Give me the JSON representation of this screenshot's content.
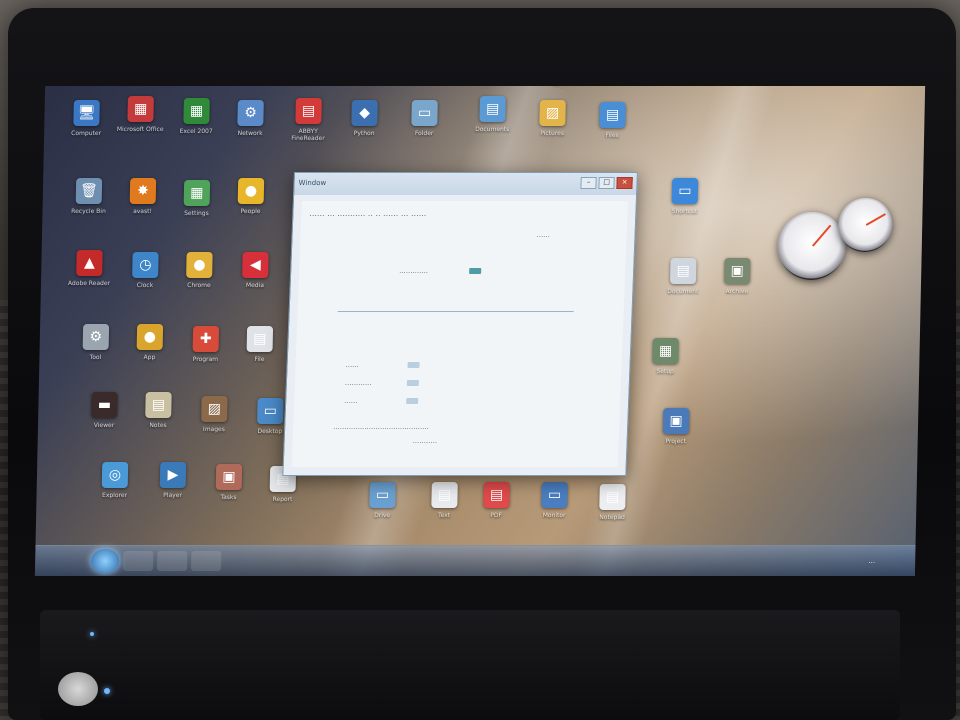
{
  "desktop": {
    "icons": [
      {
        "label": "Computer",
        "glyph": "🖥",
        "color": "#3a78c4"
      },
      {
        "label": "Microsoft Office",
        "glyph": "▦",
        "color": "#c43b3b"
      },
      {
        "label": "Excel 2007",
        "glyph": "▦",
        "color": "#2f8a3a"
      },
      {
        "label": "Network",
        "glyph": "⚙",
        "color": "#5a8ac8"
      },
      {
        "label": "ABBYY FineReader",
        "glyph": "▤",
        "color": "#d33b3b"
      },
      {
        "label": "Python",
        "glyph": "◆",
        "color": "#3c6fb0"
      },
      {
        "label": "Folder",
        "glyph": "▭",
        "color": "#7aa6cc"
      },
      {
        "label": "Documents",
        "glyph": "▤",
        "color": "#5b9ad2"
      },
      {
        "label": "Pictures",
        "glyph": "▨",
        "color": "#e3b44a"
      },
      {
        "label": "Files",
        "glyph": "▤",
        "color": "#4a8ed6"
      },
      {
        "label": "Recycle Bin",
        "glyph": "🗑",
        "color": "#6f8fb0"
      },
      {
        "label": "avast!",
        "glyph": "✸",
        "color": "#e07a1f"
      },
      {
        "label": "Settings",
        "glyph": "▦",
        "color": "#4fa35a"
      },
      {
        "label": "People",
        "glyph": "●",
        "color": "#e8b62a"
      },
      {
        "label": "Shortcut",
        "glyph": "▭",
        "color": "#3d88d8"
      },
      {
        "label": "Adobe Reader",
        "glyph": "▲",
        "color": "#c42a2a"
      },
      {
        "label": "Clock",
        "glyph": "◷",
        "color": "#3e86c9"
      },
      {
        "label": "Chrome",
        "glyph": "●",
        "color": "#e2b13a"
      },
      {
        "label": "Media",
        "glyph": "◀",
        "color": "#d8303a"
      },
      {
        "label": "Document",
        "glyph": "▤",
        "color": "#cfd6de"
      },
      {
        "label": "Archive",
        "glyph": "▣",
        "color": "#7a8a70"
      },
      {
        "label": "Tool",
        "glyph": "⚙",
        "color": "#9aa5b0"
      },
      {
        "label": "App",
        "glyph": "●",
        "color": "#d9a52d"
      },
      {
        "label": "Program",
        "glyph": "✚",
        "color": "#d84a3a"
      },
      {
        "label": "File",
        "glyph": "▤",
        "color": "#dfe3e8"
      },
      {
        "label": "Setup",
        "glyph": "▦",
        "color": "#6f8a6a"
      },
      {
        "label": "Viewer",
        "glyph": "▬",
        "color": "#3a2a2a"
      },
      {
        "label": "Notes",
        "glyph": "▤",
        "color": "#c8c0a0"
      },
      {
        "label": "Images",
        "glyph": "▨",
        "color": "#8a6a4a"
      },
      {
        "label": "Desktop",
        "glyph": "▭",
        "color": "#4a8ac8"
      },
      {
        "label": "Project",
        "glyph": "▣",
        "color": "#4a7ab8"
      },
      {
        "label": "Explorer",
        "glyph": "◎",
        "color": "#4a9ad8"
      },
      {
        "label": "Player",
        "glyph": "▶",
        "color": "#3a7ab8"
      },
      {
        "label": "Tasks",
        "glyph": "▣",
        "color": "#b06a5a"
      },
      {
        "label": "Report",
        "glyph": "▤",
        "color": "#e6e9ec"
      },
      {
        "label": "Drive",
        "glyph": "▭",
        "color": "#6aa0d0"
      },
      {
        "label": "Text",
        "glyph": "▤",
        "color": "#e8eaee"
      },
      {
        "label": "PDF",
        "glyph": "▤",
        "color": "#e04a4a"
      },
      {
        "label": "Monitor",
        "glyph": "▭",
        "color": "#4a7ec0"
      },
      {
        "label": "Notepad",
        "glyph": "▤",
        "color": "#eceef0"
      }
    ]
  },
  "dialog": {
    "title": "Window",
    "minimize": "–",
    "maximize": "□",
    "close": "×",
    "heading": "...... ... ........... .. .. ...... ... ......",
    "link": "......",
    "row_top": ".............",
    "rows": [
      "......",
      "............",
      "......"
    ],
    "footer": "...........................................",
    "footer2": "..........."
  },
  "taskbar": {
    "time": "..."
  },
  "colors": {
    "bezel": "#0c0c0e",
    "window_frame": "#7f9db9",
    "accent": "#3a78c4"
  }
}
